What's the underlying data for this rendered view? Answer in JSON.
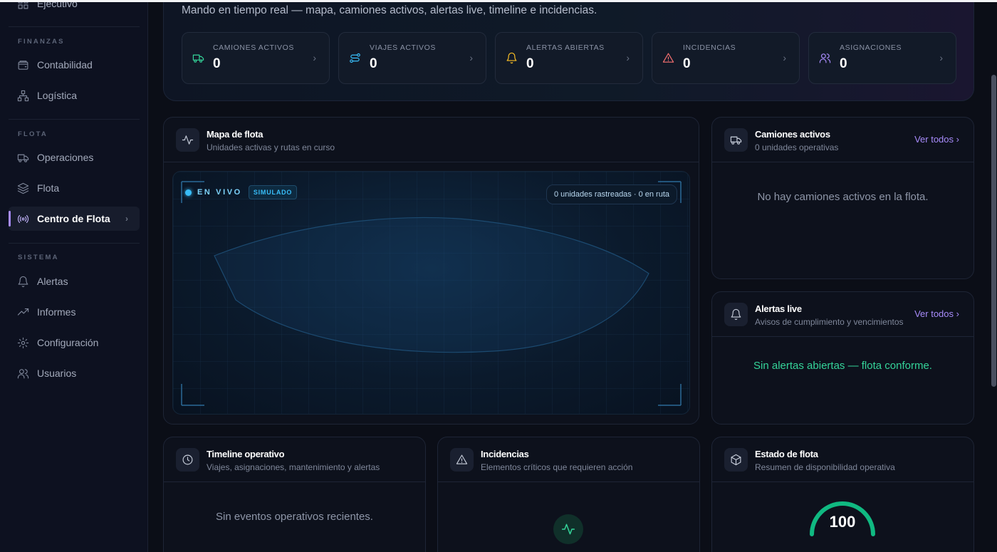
{
  "sidebar": {
    "items": [
      {
        "label": "Ejecutivo",
        "icon": "dashboard-icon"
      },
      {
        "label": "Contabilidad",
        "icon": "wallet-icon"
      },
      {
        "label": "Logística",
        "icon": "network-icon"
      },
      {
        "label": "Operaciones",
        "icon": "truck-icon"
      },
      {
        "label": "Flota",
        "icon": "layers-icon"
      },
      {
        "label": "Centro de Flota",
        "icon": "radio-icon",
        "active": true
      },
      {
        "label": "Alertas",
        "icon": "bell-icon"
      },
      {
        "label": "Informes",
        "icon": "trending-up-icon"
      },
      {
        "label": "Configuración",
        "icon": "gear-icon"
      },
      {
        "label": "Usuarios",
        "icon": "users-icon"
      }
    ],
    "sections": {
      "finanzas": "FINANZAS",
      "flota": "FLOTA",
      "sistema": "SISTEMA"
    }
  },
  "header": {
    "subtitle": "Mando en tiempo real — mapa, camiones activos, alertas live, timeline e incidencias."
  },
  "kpis": [
    {
      "label": "CAMIONES ACTIVOS",
      "value": "0",
      "icon": "truck-icon",
      "color": "#34d399"
    },
    {
      "label": "VIAJES ACTIVOS",
      "value": "0",
      "icon": "route-icon",
      "color": "#38bdf8"
    },
    {
      "label": "ALERTAS ABIERTAS",
      "value": "0",
      "icon": "bell-icon",
      "color": "#fbbf24"
    },
    {
      "label": "INCIDENCIAS",
      "value": "0",
      "icon": "warning-icon",
      "color": "#f87171"
    },
    {
      "label": "ASIGNACIONES",
      "value": "0",
      "icon": "users-icon",
      "color": "#a78bfa"
    }
  ],
  "map_panel": {
    "title": "Mapa de flota",
    "subtitle": "Unidades activas y rutas en curso",
    "live_label": "EN VIVO",
    "sim_label": "SIMULADO",
    "tracking": "0 unidades rastreadas · 0 en ruta"
  },
  "trucks_panel": {
    "title": "Camiones activos",
    "subtitle": "0 unidades operativas",
    "link": "Ver todos",
    "empty": "No hay camiones activos en la flota."
  },
  "alerts_panel": {
    "title": "Alertas live",
    "subtitle": "Avisos de cumplimiento y vencimientos",
    "link": "Ver todos",
    "empty": "Sin alertas abiertas — flota conforme."
  },
  "timeline_panel": {
    "title": "Timeline operativo",
    "subtitle": "Viajes, asignaciones, mantenimiento y alertas",
    "empty": "Sin eventos operativos recientes."
  },
  "incidents_panel": {
    "title": "Incidencias",
    "subtitle": "Elementos críticos que requieren acción"
  },
  "status_panel": {
    "title": "Estado de flota",
    "subtitle": "Resumen de disponibilidad operativa",
    "gauge_value": "100",
    "gauge_fraction": 1.0
  },
  "colors": {
    "accent": "#a78bfa",
    "success": "#34d399",
    "live": "#38bdf8"
  }
}
